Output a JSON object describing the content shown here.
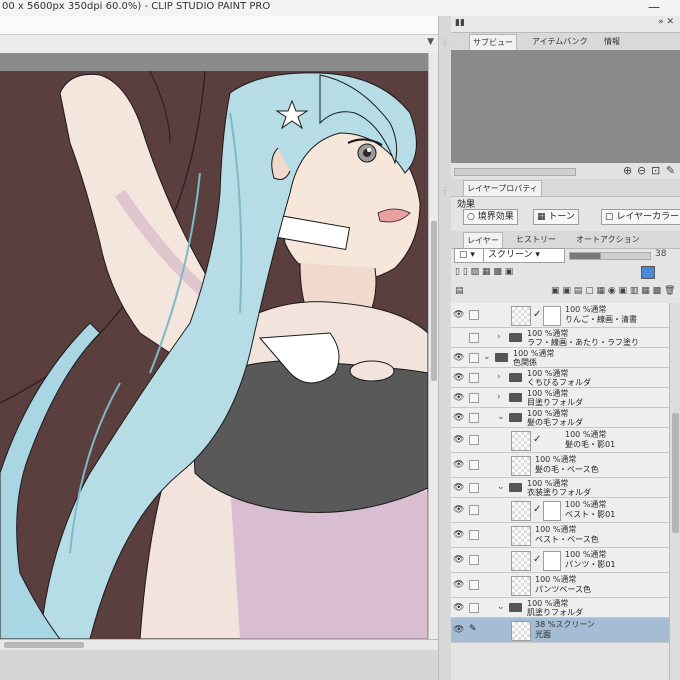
{
  "window": {
    "title": "00 x 5600px 350dpi 60.0%) - CLIP STUDIO PAINT PRO",
    "minimize": "—"
  },
  "panel_tabs_top": [
    {
      "label": "サブビュー",
      "active": true
    },
    {
      "label": "アイテムバンク",
      "active": false
    },
    {
      "label": "情報",
      "active": false
    }
  ],
  "panel_tabs_props": [
    {
      "label": "レイヤープロパティ",
      "active": true
    }
  ],
  "effects": {
    "label": "効果",
    "buttons": [
      "境界効果",
      "トーン",
      "レイヤーカラー"
    ]
  },
  "panel_tabs_layer": [
    {
      "label": "レイヤー",
      "active": true
    },
    {
      "label": "ヒストリー",
      "active": false
    },
    {
      "label": "オートアクション",
      "active": false
    }
  ],
  "blend_mode": "スクリーン",
  "opacity_value": "38",
  "accent_color": "#a5bcd5",
  "canvas_bg_color": "#5b3f3f",
  "layers": [
    {
      "type": "layer",
      "indent": 2,
      "line1": "100 %通常",
      "line2": "りんご・線画・清書",
      "mask": true,
      "visible": true
    },
    {
      "type": "folder",
      "indent": 1,
      "expanded": false,
      "line1": "100 %通常",
      "line2": "ラフ・線画・あたり・ラフ塗り",
      "visible": false
    },
    {
      "type": "folder",
      "indent": 0,
      "expanded": true,
      "line1": "100 %通常",
      "line2": "色関係",
      "visible": true
    },
    {
      "type": "folder",
      "indent": 1,
      "expanded": false,
      "line1": "100 %通常",
      "line2": "くちびるフォルダ",
      "visible": true
    },
    {
      "type": "folder",
      "indent": 1,
      "expanded": false,
      "line1": "100 %通常",
      "line2": "目塗りフォルダ",
      "visible": true
    },
    {
      "type": "folder",
      "indent": 1,
      "expanded": true,
      "line1": "100 %通常",
      "line2": "髪の毛フォルダ",
      "visible": true
    },
    {
      "type": "layer",
      "indent": 2,
      "line1": "100 %通常",
      "line2": "髪の毛・影01",
      "mask": false,
      "clip": true,
      "visible": true
    },
    {
      "type": "layer",
      "indent": 2,
      "line1": "100 %通常",
      "line2": "髪の毛・ベース色",
      "mask": false,
      "visible": true
    },
    {
      "type": "folder",
      "indent": 1,
      "expanded": true,
      "line1": "100 %通常",
      "line2": "衣装塗りフォルダ",
      "visible": true
    },
    {
      "type": "layer",
      "indent": 2,
      "line1": "100 %通常",
      "line2": "ベスト・影01",
      "mask": true,
      "visible": true
    },
    {
      "type": "layer",
      "indent": 2,
      "line1": "100 %通常",
      "line2": "ベスト・ベース色",
      "mask": false,
      "visible": true
    },
    {
      "type": "layer",
      "indent": 2,
      "line1": "100 %通常",
      "line2": "パンツ・影01",
      "mask": true,
      "visible": true
    },
    {
      "type": "layer",
      "indent": 2,
      "line1": "100 %通常",
      "line2": "パンツベース色",
      "mask": false,
      "visible": true
    },
    {
      "type": "folder",
      "indent": 1,
      "expanded": true,
      "line1": "100 %通常",
      "line2": "肌塗りフォルダ",
      "visible": true
    },
    {
      "type": "layer",
      "indent": 2,
      "line1": "38 %スクリーン",
      "line2": "光面",
      "mask": false,
      "visible": true,
      "active": true,
      "pen": true
    }
  ]
}
